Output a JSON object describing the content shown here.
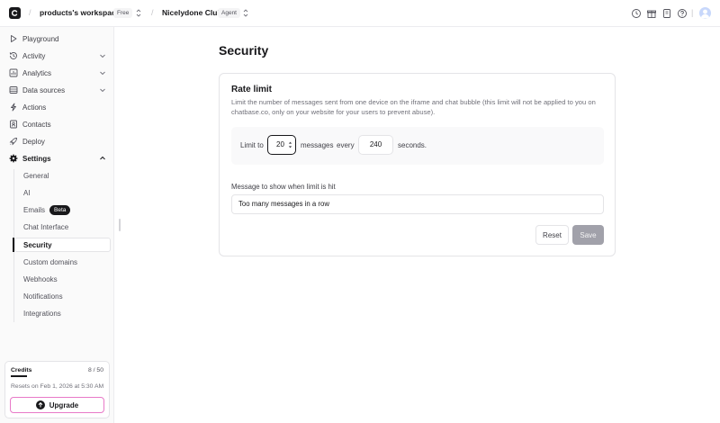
{
  "topbar": {
    "workspace_name": "products's workspace",
    "workspace_plan": "Free",
    "agent_name": "Nicelydone Club",
    "agent_badge": "Agent",
    "separator": "/",
    "icons": [
      "history-icon",
      "gift-icon",
      "book-icon",
      "help-icon",
      "avatar"
    ]
  },
  "sidebar": {
    "items": [
      {
        "label": "Playground",
        "icon": "play-icon"
      },
      {
        "label": "Activity",
        "icon": "activity-icon"
      },
      {
        "label": "Analytics",
        "icon": "chart-icon"
      },
      {
        "label": "Data sources",
        "icon": "database-icon"
      },
      {
        "label": "Actions",
        "icon": "actions-icon"
      },
      {
        "label": "Contacts",
        "icon": "contacts-icon"
      },
      {
        "label": "Deploy",
        "icon": "rocket-icon"
      },
      {
        "label": "Settings",
        "icon": "gear-icon"
      }
    ],
    "settings_sub": [
      {
        "label": "General"
      },
      {
        "label": "AI"
      },
      {
        "label": "Emails",
        "badge": "Beta"
      },
      {
        "label": "Chat Interface"
      },
      {
        "label": "Security",
        "active": true
      },
      {
        "label": "Custom domains"
      },
      {
        "label": "Webhooks"
      },
      {
        "label": "Notifications"
      },
      {
        "label": "Integrations"
      }
    ],
    "credits": {
      "title": "Credits",
      "count": "8 / 50",
      "reset_text": "Resets on Feb 1, 2026 at 5:30 AM",
      "upgrade_label": "Upgrade"
    }
  },
  "main": {
    "page_title": "Security",
    "rate_limit": {
      "title": "Rate limit",
      "description": "Limit the number of messages sent from one device on the iframe and chat bubble (this limit will not be applied to you on chatbase.co, only on your website for your users to prevent abuse).",
      "limit_to_label": "Limit to",
      "messages_value": "20",
      "messages_label": "messages",
      "every_label": "every",
      "seconds_value": "240",
      "seconds_label": "seconds.",
      "message_label": "Message to show when limit is hit",
      "message_value": "Too many messages in a row",
      "reset_label": "Reset",
      "save_label": "Save"
    }
  },
  "colors": {
    "text_primary": "#18181b",
    "text_muted": "#71717a",
    "border": "#e4e4e7",
    "save_disabled": "#a1a1aa",
    "upgrade_border": "#e879c8"
  }
}
